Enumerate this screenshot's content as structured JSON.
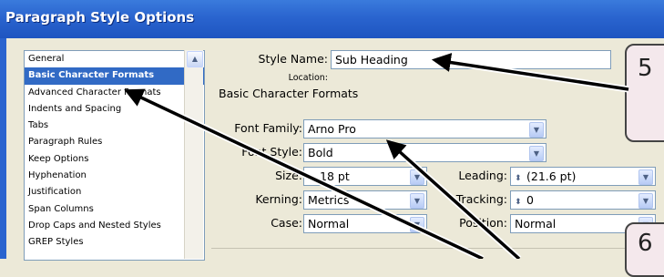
{
  "window": {
    "title": "Paragraph Style Options"
  },
  "sidebar": {
    "items": [
      {
        "label": "General"
      },
      {
        "label": "Basic Character Formats"
      },
      {
        "label": "Advanced Character Formats"
      },
      {
        "label": "Indents and Spacing"
      },
      {
        "label": "Tabs"
      },
      {
        "label": "Paragraph Rules"
      },
      {
        "label": "Keep Options"
      },
      {
        "label": "Hyphenation"
      },
      {
        "label": "Justification"
      },
      {
        "label": "Span Columns"
      },
      {
        "label": "Drop Caps and Nested Styles"
      },
      {
        "label": "GREP Styles"
      }
    ],
    "selected": "Basic Character Formats"
  },
  "form": {
    "style_name_label": "Style Name:",
    "style_name_value": "Sub Heading",
    "location_label": "Location:",
    "section_title": "Basic Character Formats",
    "font_family_label": "Font Family:",
    "font_family_value": "Arno Pro",
    "font_style_label": "Font Style:",
    "font_style_value": "Bold",
    "size_label": "Size:",
    "size_value": "18 pt",
    "leading_label": "Leading:",
    "leading_value": "(21.6 pt)",
    "kerning_label": "Kerning:",
    "kerning_value": "Metrics",
    "tracking_label": "Tracking:",
    "tracking_value": "0",
    "case_label": "Case:",
    "case_value": "Normal",
    "position_label": "Position:",
    "position_value": "Normal"
  },
  "callouts": {
    "step_5": "5",
    "step_6": "6"
  },
  "colors": {
    "title_bar": "#2a64cf",
    "selection": "#316ac5",
    "callout_fill": "#f4e8ec",
    "arrow": "#000000"
  }
}
